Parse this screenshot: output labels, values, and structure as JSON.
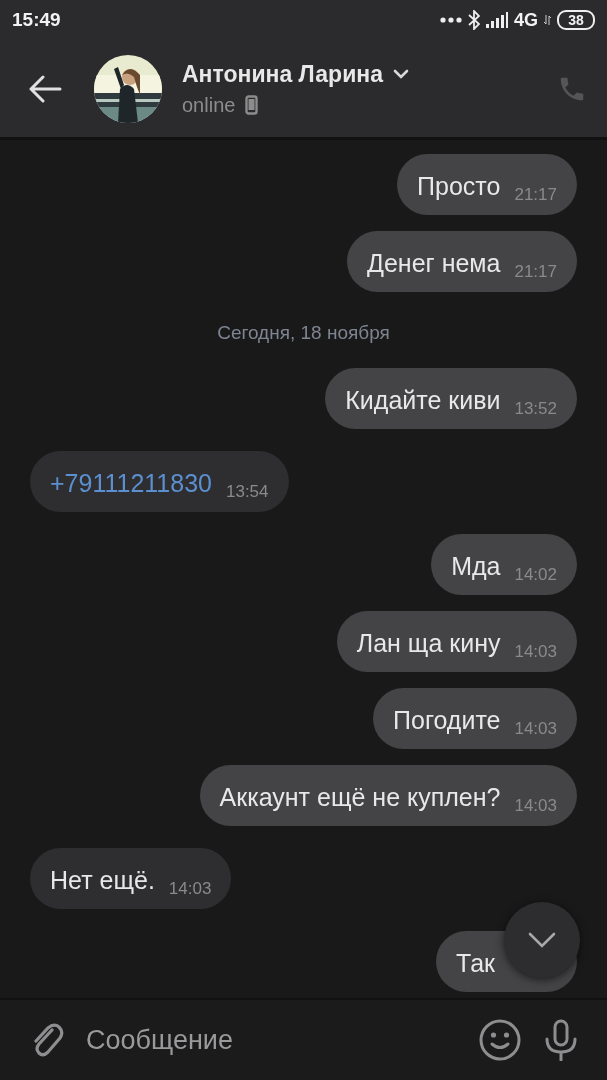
{
  "status_bar": {
    "time": "15:49",
    "network": "4G",
    "battery": "38"
  },
  "header": {
    "name": "Антонина Ларина",
    "status": "online"
  },
  "messages": [
    {
      "kind": "message",
      "outgoing": true,
      "text": "Просто",
      "time": "21:17",
      "link": false
    },
    {
      "kind": "message",
      "outgoing": true,
      "text": "Денег нема",
      "time": "21:17",
      "link": false
    },
    {
      "kind": "date",
      "text": "Сегодня, 18 ноября"
    },
    {
      "kind": "message",
      "outgoing": true,
      "text": "Кидайте киви",
      "time": "13:52",
      "link": false
    },
    {
      "kind": "message",
      "outgoing": false,
      "text": "+79111211830",
      "time": "13:54",
      "link": true
    },
    {
      "kind": "message",
      "outgoing": true,
      "text": "Мда",
      "time": "14:02",
      "link": false
    },
    {
      "kind": "message",
      "outgoing": true,
      "text": "Лан ща кину",
      "time": "14:03",
      "link": false
    },
    {
      "kind": "message",
      "outgoing": true,
      "text": "Погодите",
      "time": "14:03",
      "link": false
    },
    {
      "kind": "message",
      "outgoing": true,
      "text": "Аккаунт ещё не куплен?",
      "time": "14:03",
      "link": false
    },
    {
      "kind": "message",
      "outgoing": false,
      "text": "Нет ещё.",
      "time": "14:03",
      "link": false
    },
    {
      "kind": "message",
      "outgoing": true,
      "text": "Так",
      "link": false
    }
  ],
  "composer": {
    "placeholder": "Сообщение"
  }
}
